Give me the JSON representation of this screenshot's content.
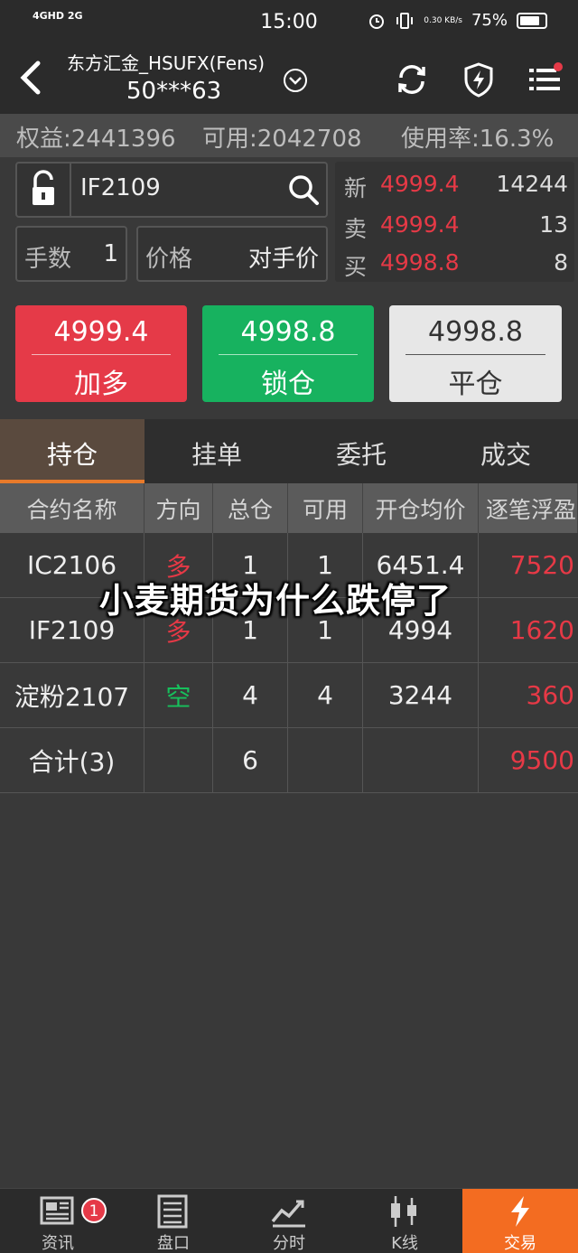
{
  "status_bar": {
    "network": "4GHD 2G",
    "time": "15:00",
    "speed": "0.30 KB/s",
    "battery": "75%"
  },
  "header": {
    "account_name": "东方汇金_HSUFX(Fens)",
    "account_id": "50***63"
  },
  "summary": {
    "equity": "权益:2441396",
    "available": "可用:2042708",
    "usage": "使用率:16.3%"
  },
  "order": {
    "contract": "IF2109",
    "qty_label": "手数",
    "qty_value": "1",
    "price_label": "价格",
    "price_value": "对手价"
  },
  "quote": {
    "rows": [
      {
        "label": "新",
        "price": "4999.4",
        "volume": "14244"
      },
      {
        "label": "卖",
        "price": "4999.4",
        "volume": "13"
      },
      {
        "label": "买",
        "price": "4998.8",
        "volume": "8"
      }
    ]
  },
  "trade_buttons": {
    "buy": {
      "price": "4999.4",
      "label": "加多"
    },
    "lock": {
      "price": "4998.8",
      "label": "锁仓"
    },
    "close": {
      "price": "4998.8",
      "label": "平仓"
    }
  },
  "tabs": [
    "持仓",
    "挂单",
    "委托",
    "成交"
  ],
  "table": {
    "headers": [
      "合约名称",
      "方向",
      "总仓",
      "可用",
      "开仓均价",
      "逐笔浮盈"
    ],
    "rows": [
      {
        "name": "IC2106",
        "direction": "多",
        "total": "1",
        "available": "1",
        "avg_price": "6451.4",
        "pnl": "7520"
      },
      {
        "name": "IF2109",
        "direction": "多",
        "total": "1",
        "available": "1",
        "avg_price": "4994",
        "pnl": "1620"
      },
      {
        "name": "淀粉2107",
        "direction": "空",
        "total": "4",
        "available": "4",
        "avg_price": "3244",
        "pnl": "360"
      }
    ],
    "total_row": {
      "name": "合计(3)",
      "total": "6",
      "pnl": "9500"
    }
  },
  "watermark": "小麦期货为什么跌停了",
  "bottom_nav": {
    "items": [
      "资讯",
      "盘口",
      "分时",
      "K线",
      "交易"
    ],
    "badge": "1"
  },
  "colors": {
    "up": "#e63946",
    "down": "#17c05c",
    "accent": "#f36c21"
  }
}
